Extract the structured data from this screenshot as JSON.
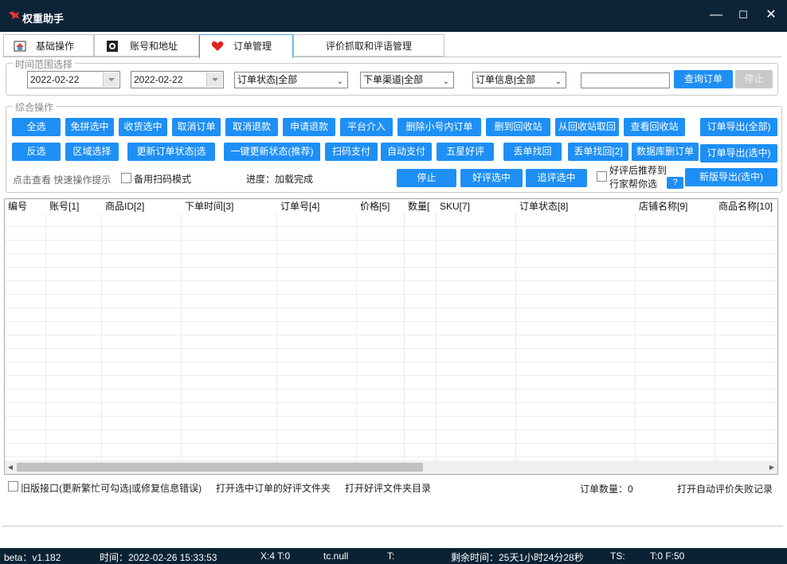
{
  "window": {
    "title": "权重助手",
    "minimize": "—",
    "maximize": "☐",
    "close": "✕"
  },
  "tabs": [
    "基础操作",
    "账号和地址",
    "订单管理",
    "评价抓取和评语管理"
  ],
  "time_range": {
    "legend": "时间范围选择",
    "start_date": "2022-02-22",
    "end_date": "2022-02-22",
    "order_status": "订单状态|全部",
    "order_channel": "下单渠道|全部",
    "order_info": "订单信息|全部",
    "search_value": "",
    "query_button": "查询订单",
    "stop_button": "停止"
  },
  "ops": {
    "legend": "综合操作",
    "row1": [
      "全选",
      "免拼选中",
      "收货选中",
      "取消订单",
      "取消退款",
      "申请退款",
      "平台介入",
      "删除小号内订单",
      "删到回收站",
      "从回收站取回",
      "查看回收站",
      "订单导出(全部)"
    ],
    "row2": [
      "反选",
      "区域选择",
      "更新订单状态|选",
      "一键更新状态(推荐)",
      "扫码支付",
      "自动支付",
      "五星好评",
      "丢单找回",
      "丢单找回[2]",
      "数据库删订单",
      "订单导出(选中)"
    ],
    "hint": "点击查看  快速操作提示",
    "backup_scan": "备用扫码模式",
    "progress": "进度：加载完成",
    "row3": [
      "停止",
      "好评选中",
      "追评选中"
    ],
    "recommend_line1": "好评后推荐到",
    "recommend_line2": "行家帮你选",
    "help": "?",
    "new_export": "新版导出(选中)"
  },
  "grid": {
    "columns": [
      "编号",
      "账号[1]",
      "商品ID[2]",
      "下单时间[3]",
      "订单号[4]",
      "价格[5]",
      "数量[",
      "SKU[7]",
      "订单状态[8]",
      "店铺名称[9]",
      "商品名称[10]"
    ],
    "rows": []
  },
  "bottom": {
    "old_api": "旧版接口(更新繁忙可勾选|或修复信息错误)",
    "open_selected_folder": "打开选中订单的好评文件夹",
    "open_folder_dir": "打开好评文件夹目录",
    "order_count": "订单数量：0",
    "open_failure_log": "打开自动评价失败记录"
  },
  "status": {
    "version": "beta：v1.182",
    "time": "时间：2022-02-26 15:33:53",
    "xt": "X:4 T:0",
    "tc": "tc.null",
    "t": "T:",
    "remaining": "剩余时间：25天1小时24分28秒",
    "ts": "TS:",
    "tf": "T:0 F:50"
  },
  "colors": {
    "button": "#1e8ff5",
    "titlebar": "#0d2438",
    "grid_header": "#b3c6d6"
  },
  "icons": [
    "app-logo-icon",
    "house-icon",
    "gear-icon",
    "heart-icon",
    "minimize-icon",
    "maximize-icon",
    "close-icon"
  ]
}
